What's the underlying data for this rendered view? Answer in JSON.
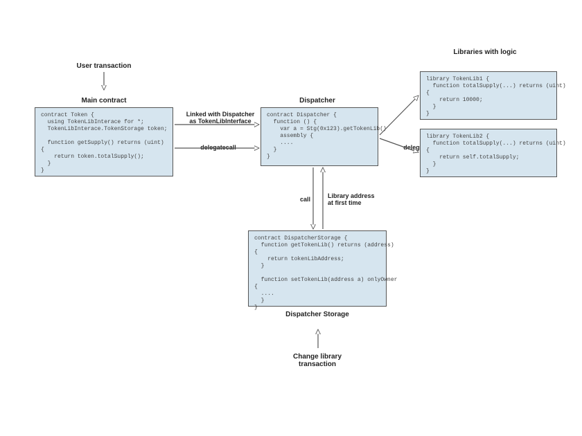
{
  "titles": {
    "user_tx": "User transaction",
    "main_contract": "Main contract",
    "dispatcher": "Dispatcher",
    "libraries": "Libraries with logic",
    "dispatcher_storage": "Dispatcher Storage",
    "change_lib_tx": "Change library\ntransaction"
  },
  "arrows": {
    "linked_with": "Linked with Dispatcher\nas TokenLibInterface",
    "delegatecall1": "delegatecall",
    "delegatecall2": "delegatecall",
    "call": "call",
    "lib_addr": "Library address\nat first time"
  },
  "code": {
    "main": "contract Token {\n  using TokenLibInterace for *;\n  TokenLibInterace.TokenStorage token;\n\n  function getSupply() returns (uint)\n{\n    return token.totalSupply();\n  }\n}",
    "dispatcher": "contract Dispatcher {\n  function () {\n    var a = Stg(0x123).getTokenLib()\n    assembly {\n    ....\n  }\n}",
    "storage": "contract DispatcherStorage {\n  function getTokenLib() returns (address)\n{\n    return tokenLibAddress;\n  }\n\n  function setTokenLib(address a) onlyOwner\n{\n  ....\n  }\n}",
    "lib1": "library TokenLib1 {\n  function totalSupply(...) returns (uint)\n{\n    return 10000;\n  }\n}",
    "lib2": "library TokenLib2 {\n  function totalSupply(...) returns (uint)\n{\n    return self.totalSupply;\n  }\n}"
  }
}
